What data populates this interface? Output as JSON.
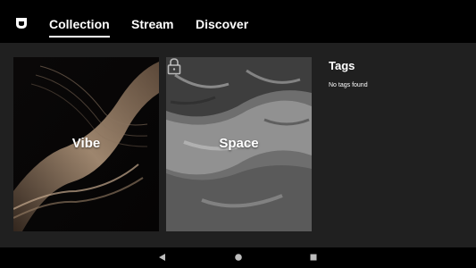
{
  "header": {
    "logo_icon": "shield-logo-icon",
    "tabs": [
      {
        "label": "Collection",
        "active": true
      },
      {
        "label": "Stream",
        "active": false
      },
      {
        "label": "Discover",
        "active": false
      }
    ]
  },
  "collection": {
    "cards": [
      {
        "label": "Vibe",
        "locked": false
      },
      {
        "label": "Space",
        "locked": true
      }
    ]
  },
  "tags": {
    "title": "Tags",
    "empty_text": "No tags found"
  },
  "navbar": {
    "back_icon": "back-triangle-icon",
    "home_icon": "home-circle-icon",
    "recents_icon": "recents-square-icon"
  },
  "colors": {
    "background": "#202020",
    "bar": "#000000",
    "text": "#ffffff"
  }
}
